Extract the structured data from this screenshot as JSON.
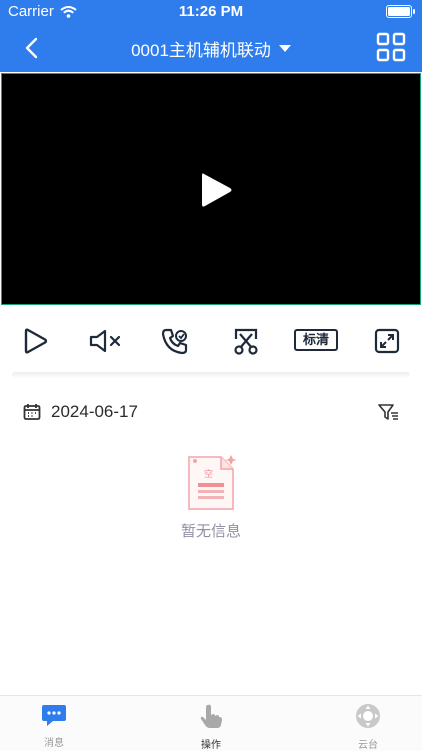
{
  "status_bar": {
    "carrier": "Carrier",
    "time": "11:26 PM"
  },
  "nav": {
    "title": "0001主机辅机联动"
  },
  "controls": {
    "quality_label": "标清"
  },
  "date_row": {
    "date": "2024-06-17"
  },
  "empty_state": {
    "message": "暂无信息"
  },
  "tabs": [
    {
      "label": "消息",
      "icon": "chat-icon",
      "active": true
    },
    {
      "label": "操作",
      "icon": "hand-pointer-icon",
      "active": false
    },
    {
      "label": "云台",
      "icon": "ptz-icon",
      "active": false
    }
  ],
  "colors": {
    "primary": "#2f7dec",
    "video_border": "#18a37a",
    "empty_text": "#8f90a3",
    "tab_inactive": "#9a9a9a"
  }
}
